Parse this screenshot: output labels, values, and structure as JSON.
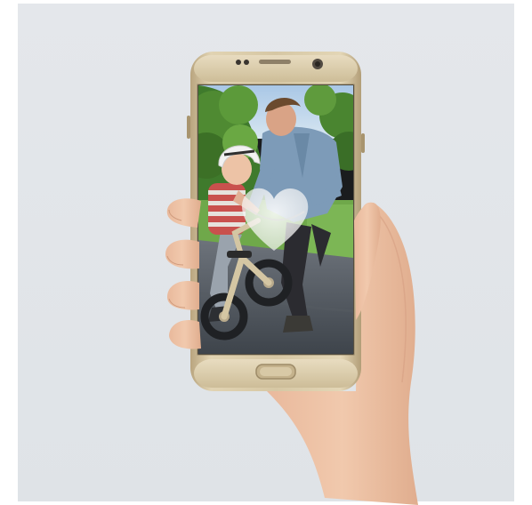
{
  "scene": {
    "description_kind": "product-photo",
    "device": "smartphone",
    "device_color": "#d2c29e",
    "screen_content": "parent-teaching-child-balance-bike",
    "overlay": "heart-icon",
    "background_color": "#e2e5e9"
  }
}
